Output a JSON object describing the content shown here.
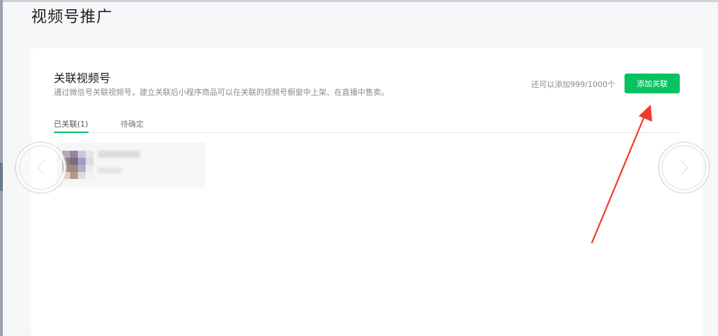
{
  "page": {
    "title": "视频号推广"
  },
  "section": {
    "title": "关联视频号",
    "description": "通过微信号关联视频号，建立关联后小程序商品可以在关联的视频号橱窗中上架、在直播中售卖。",
    "quota_text": "还可以添加999/1000个",
    "add_button_label": "添加关联"
  },
  "tabs": [
    {
      "label": "已关联(1)",
      "active": true
    },
    {
      "label": "待确定",
      "active": false
    }
  ],
  "colors": {
    "accent": "#07c160",
    "annotation_arrow": "#f23a2a"
  },
  "icons": {
    "prev": "chevron-left-icon",
    "next": "chevron-right-icon"
  }
}
